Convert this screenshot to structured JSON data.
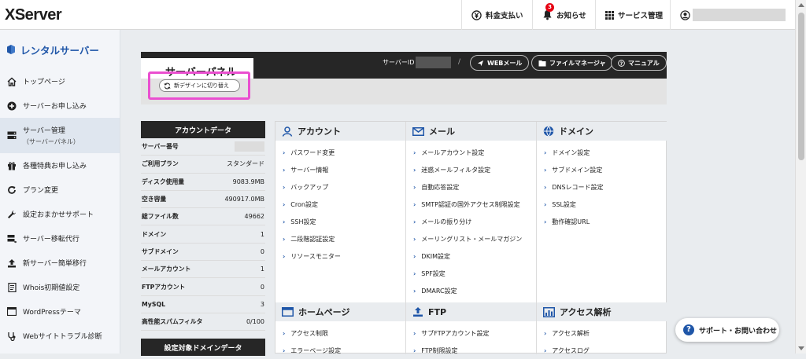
{
  "topbar": {
    "logo": "XServer",
    "payment": "料金支払い",
    "notice": "お知らせ",
    "notice_count": "3",
    "services": "サービス管理"
  },
  "sidebar": {
    "title": "レンタルサーバー",
    "items": [
      {
        "label": "トップページ",
        "icon": "home-icon"
      },
      {
        "label": "サーバーお申し込み",
        "icon": "plus-circle-icon"
      },
      {
        "label": "サーバー管理",
        "sub": "（サーバーパネル）",
        "icon": "server-icon"
      },
      {
        "label": "各種特典お申し込み",
        "icon": "gift-icon"
      },
      {
        "label": "プラン変更",
        "icon": "refresh-icon"
      },
      {
        "label": "設定おまかせサポート",
        "icon": "wrench-icon"
      },
      {
        "label": "サーバー移転代行",
        "icon": "server-move-icon"
      },
      {
        "label": "新サーバー簡単移行",
        "icon": "upload-icon"
      },
      {
        "label": "Whois初期値設定",
        "icon": "document-icon"
      },
      {
        "label": "WordPressテーマ",
        "icon": "window-icon"
      },
      {
        "label": "Webサイトトラブル診断",
        "icon": "stethoscope-icon"
      }
    ]
  },
  "panel": {
    "title": "サーバーパネル",
    "switch_button": "新デザインに切り替え",
    "server_id_label": "サーバーID",
    "web_mail": "WEBメール",
    "file_manager": "ファイルマネージャ",
    "manual": "マニュアル"
  },
  "account": {
    "header": "アカウントデータ",
    "rows": [
      {
        "label": "サーバー番号",
        "value": ""
      },
      {
        "label": "ご利用プラン",
        "value": "スタンダード"
      },
      {
        "label": "ディスク使用量",
        "value": "9083.9MB"
      },
      {
        "label": "空き容量",
        "value": "490917.0MB"
      },
      {
        "label": "総ファイル数",
        "value": "49662"
      },
      {
        "label": "ドメイン",
        "value": "1"
      },
      {
        "label": "サブドメイン",
        "value": "0"
      },
      {
        "label": "メールアカウント",
        "value": "1"
      },
      {
        "label": "FTPアカウント",
        "value": "0"
      },
      {
        "label": "MySQL",
        "value": "3"
      },
      {
        "label": "高性能スパムフィルタ",
        "value": "0/100"
      }
    ],
    "header2": "設定対象ドメインデータ"
  },
  "menu": {
    "account": {
      "title": "アカウント",
      "items": [
        "パスワード変更",
        "サーバー情報",
        "バックアップ",
        "Cron設定",
        "SSH設定",
        "二段階認証設定",
        "リソースモニター"
      ]
    },
    "mail": {
      "title": "メール",
      "items": [
        "メールアカウント設定",
        "迷惑メールフィルタ設定",
        "自動応答設定",
        "SMTP認証の国外アクセス制限設定",
        "メールの振り分け",
        "メーリングリスト・メールマガジン",
        "DKIM設定",
        "SPF設定",
        "DMARC設定"
      ]
    },
    "domain": {
      "title": "ドメイン",
      "items": [
        "ドメイン設定",
        "サブドメイン設定",
        "DNSレコード設定",
        "SSL設定",
        "動作確認URL"
      ]
    },
    "homepage": {
      "title": "ホームページ",
      "items": [
        "アクセス制限",
        "エラーページ設定"
      ]
    },
    "ftp": {
      "title": "FTP",
      "items": [
        "サブFTPアカウント設定",
        "FTP制限設定"
      ]
    },
    "analytics": {
      "title": "アクセス解析",
      "items": [
        "アクセス解析",
        "アクセスログ"
      ]
    }
  },
  "support": {
    "label": "サポート・お問い合わせ"
  },
  "colors": {
    "accent": "#1f56a8",
    "dark": "#262626",
    "highlight": "#ea4fd0",
    "badge": "#e60012"
  }
}
